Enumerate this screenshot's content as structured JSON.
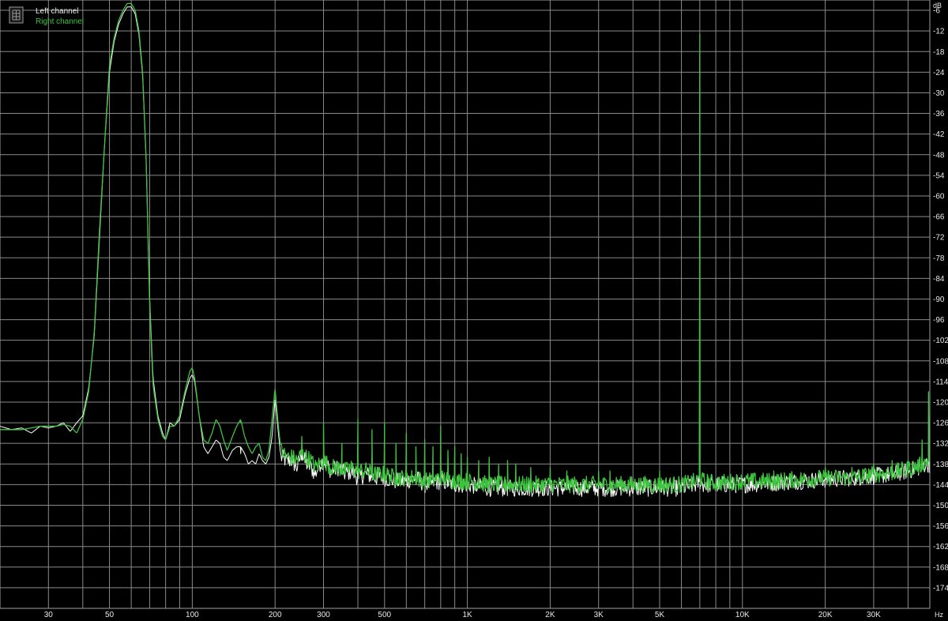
{
  "chart_data": {
    "type": "line",
    "title": "",
    "xlabel": "",
    "ylabel": "",
    "x_unit": "Hz",
    "y_unit": "dB",
    "x_scale": "log",
    "xlim": [
      20,
      48000
    ],
    "ylim": [
      -180,
      -3
    ],
    "grid": true,
    "legend_placement": "top-left",
    "background": "#000000",
    "grid_color": "#8a8a8a",
    "x_ticks": [
      {
        "value": 30,
        "label": "30"
      },
      {
        "value": 50,
        "label": "50"
      },
      {
        "value": 100,
        "label": "100"
      },
      {
        "value": 200,
        "label": "200"
      },
      {
        "value": 300,
        "label": "300"
      },
      {
        "value": 500,
        "label": "500"
      },
      {
        "value": 1000,
        "label": "1K"
      },
      {
        "value": 2000,
        "label": "2K"
      },
      {
        "value": 3000,
        "label": "3K"
      },
      {
        "value": 5000,
        "label": "5K"
      },
      {
        "value": 10000,
        "label": "10K"
      },
      {
        "value": 20000,
        "label": "20K"
      },
      {
        "value": 30000,
        "label": "30K"
      }
    ],
    "y_ticks": [
      -6,
      -12,
      -18,
      -24,
      -30,
      -36,
      -42,
      -48,
      -54,
      -60,
      -66,
      -72,
      -78,
      -84,
      -90,
      -96,
      -102,
      -108,
      -114,
      -120,
      -126,
      -132,
      -138,
      -144,
      -150,
      -156,
      -162,
      -168,
      -174
    ],
    "series": [
      {
        "name": "Left channel",
        "color": "#ffffff",
        "points": [
          [
            20,
            -127
          ],
          [
            22,
            -128
          ],
          [
            24,
            -127.5
          ],
          [
            26,
            -129
          ],
          [
            28,
            -127
          ],
          [
            30,
            -127.5
          ],
          [
            32,
            -127
          ],
          [
            34,
            -126
          ],
          [
            36,
            -128.5
          ],
          [
            38,
            -126
          ],
          [
            40,
            -124
          ],
          [
            42,
            -116
          ],
          [
            44,
            -101
          ],
          [
            46,
            -72
          ],
          [
            48,
            -45
          ],
          [
            50,
            -24
          ],
          [
            52,
            -15
          ],
          [
            54,
            -10
          ],
          [
            56,
            -7
          ],
          [
            58,
            -5
          ],
          [
            60,
            -5
          ],
          [
            62,
            -7
          ],
          [
            64,
            -13
          ],
          [
            66,
            -25
          ],
          [
            68,
            -50
          ],
          [
            70,
            -90
          ],
          [
            72,
            -113
          ],
          [
            75,
            -124
          ],
          [
            78,
            -129
          ],
          [
            80,
            -131
          ],
          [
            83,
            -126
          ],
          [
            86,
            -127
          ],
          [
            90,
            -125
          ],
          [
            94,
            -118
          ],
          [
            98,
            -113
          ],
          [
            100,
            -112
          ],
          [
            102,
            -114
          ],
          [
            106,
            -124
          ],
          [
            110,
            -133
          ],
          [
            114,
            -135
          ],
          [
            118,
            -133
          ],
          [
            122,
            -131
          ],
          [
            126,
            -132
          ],
          [
            130,
            -136
          ],
          [
            134,
            -137
          ],
          [
            140,
            -134
          ],
          [
            145,
            -133
          ],
          [
            150,
            -133
          ],
          [
            155,
            -135
          ],
          [
            160,
            -138
          ],
          [
            165,
            -137
          ],
          [
            170,
            -138
          ],
          [
            175,
            -135
          ],
          [
            180,
            -137
          ],
          [
            185,
            -138
          ],
          [
            190,
            -136
          ],
          [
            195,
            -130
          ],
          [
            200,
            -119
          ],
          [
            205,
            -128
          ],
          [
            210,
            -136
          ],
          [
            220,
            -137
          ],
          [
            230,
            -137
          ],
          [
            240,
            -139
          ],
          [
            250,
            -135
          ],
          [
            260,
            -138
          ],
          [
            270,
            -139
          ],
          [
            280,
            -141
          ],
          [
            290,
            -138
          ],
          [
            300,
            -137
          ],
          [
            320,
            -140
          ],
          [
            340,
            -139
          ],
          [
            360,
            -141
          ],
          [
            380,
            -140
          ],
          [
            400,
            -142
          ],
          [
            430,
            -141
          ],
          [
            460,
            -142
          ],
          [
            500,
            -142
          ],
          [
            550,
            -143
          ],
          [
            600,
            -143
          ],
          [
            650,
            -142
          ],
          [
            700,
            -144
          ],
          [
            800,
            -143
          ],
          [
            900,
            -144
          ],
          [
            1000,
            -144
          ],
          [
            1200,
            -145
          ],
          [
            1500,
            -145
          ],
          [
            2000,
            -145
          ],
          [
            2500,
            -145
          ],
          [
            3000,
            -145
          ],
          [
            4000,
            -145
          ],
          [
            5000,
            -145
          ],
          [
            6000,
            -145
          ],
          [
            6800,
            -144
          ],
          [
            7000,
            -143
          ],
          [
            7200,
            -144
          ],
          [
            8000,
            -144
          ],
          [
            10000,
            -144
          ],
          [
            13000,
            -143.5
          ],
          [
            16000,
            -143
          ],
          [
            20000,
            -142.5
          ],
          [
            25000,
            -142
          ],
          [
            30000,
            -141.5
          ],
          [
            35000,
            -141
          ],
          [
            40000,
            -140
          ],
          [
            44000,
            -139
          ],
          [
            46000,
            -138
          ],
          [
            48000,
            -138
          ]
        ]
      },
      {
        "name": "Right channel",
        "color": "#3ec43e",
        "points": [
          [
            20,
            -128
          ],
          [
            22,
            -128
          ],
          [
            24,
            -128
          ],
          [
            26,
            -127.5
          ],
          [
            28,
            -127
          ],
          [
            30,
            -127
          ],
          [
            32,
            -127
          ],
          [
            34,
            -126.5
          ],
          [
            36,
            -127
          ],
          [
            38,
            -129
          ],
          [
            40,
            -125
          ],
          [
            42,
            -117
          ],
          [
            44,
            -100
          ],
          [
            46,
            -70
          ],
          [
            48,
            -45
          ],
          [
            50,
            -22
          ],
          [
            52,
            -14
          ],
          [
            54,
            -9
          ],
          [
            56,
            -6
          ],
          [
            58,
            -4
          ],
          [
            60,
            -4
          ],
          [
            62,
            -6
          ],
          [
            64,
            -12
          ],
          [
            66,
            -24
          ],
          [
            68,
            -50
          ],
          [
            70,
            -92
          ],
          [
            72,
            -115
          ],
          [
            75,
            -125
          ],
          [
            78,
            -130
          ],
          [
            80,
            -131
          ],
          [
            83,
            -127
          ],
          [
            86,
            -127
          ],
          [
            90,
            -124
          ],
          [
            94,
            -117
          ],
          [
            98,
            -111
          ],
          [
            100,
            -110
          ],
          [
            102,
            -113
          ],
          [
            106,
            -124
          ],
          [
            110,
            -131
          ],
          [
            114,
            -132
          ],
          [
            118,
            -129
          ],
          [
            122,
            -125
          ],
          [
            126,
            -127
          ],
          [
            130,
            -131
          ],
          [
            134,
            -134
          ],
          [
            140,
            -130
          ],
          [
            145,
            -127
          ],
          [
            150,
            -125
          ],
          [
            155,
            -130
          ],
          [
            160,
            -133
          ],
          [
            165,
            -135
          ],
          [
            170,
            -133
          ],
          [
            175,
            -132
          ],
          [
            180,
            -136
          ],
          [
            185,
            -137
          ],
          [
            190,
            -134
          ],
          [
            195,
            -125
          ],
          [
            200,
            -116
          ],
          [
            205,
            -126
          ],
          [
            210,
            -134
          ],
          [
            220,
            -136
          ],
          [
            230,
            -136
          ],
          [
            240,
            -137
          ],
          [
            250,
            -135
          ],
          [
            260,
            -136
          ],
          [
            270,
            -137
          ],
          [
            280,
            -139
          ],
          [
            290,
            -138
          ],
          [
            300,
            -137
          ],
          [
            320,
            -139
          ],
          [
            340,
            -139
          ],
          [
            360,
            -140
          ],
          [
            380,
            -139
          ],
          [
            400,
            -140
          ],
          [
            430,
            -140
          ],
          [
            460,
            -141
          ],
          [
            500,
            -141
          ],
          [
            550,
            -142
          ],
          [
            600,
            -142
          ],
          [
            650,
            -142
          ],
          [
            700,
            -143
          ],
          [
            800,
            -142
          ],
          [
            900,
            -143
          ],
          [
            1000,
            -143
          ],
          [
            1200,
            -144
          ],
          [
            1500,
            -144
          ],
          [
            2000,
            -144
          ],
          [
            2500,
            -144
          ],
          [
            3000,
            -144
          ],
          [
            4000,
            -144
          ],
          [
            5000,
            -144
          ],
          [
            6000,
            -144
          ],
          [
            6800,
            -143
          ],
          [
            7000,
            -142
          ],
          [
            7200,
            -143
          ],
          [
            8000,
            -143.5
          ],
          [
            10000,
            -143
          ],
          [
            13000,
            -143
          ],
          [
            16000,
            -142.5
          ],
          [
            20000,
            -142
          ],
          [
            25000,
            -142
          ],
          [
            30000,
            -141
          ],
          [
            35000,
            -140.5
          ],
          [
            40000,
            -139.5
          ],
          [
            44000,
            -138.5
          ],
          [
            46000,
            -137.5
          ],
          [
            48000,
            -137
          ]
        ]
      }
    ],
    "peaks": [
      {
        "x": 150,
        "left": -135,
        "right": -126
      },
      {
        "x": 250,
        "left": -136,
        "right": -130
      },
      {
        "x": 300,
        "left": -134,
        "right": -126
      },
      {
        "x": 350,
        "left": -138,
        "right": -132
      },
      {
        "x": 400,
        "left": -133,
        "right": -125
      },
      {
        "x": 450,
        "left": -136,
        "right": -128
      },
      {
        "x": 500,
        "left": -134,
        "right": -126
      },
      {
        "x": 550,
        "left": -138,
        "right": -132
      },
      {
        "x": 600,
        "left": -136,
        "right": -129
      },
      {
        "x": 650,
        "left": -139,
        "right": -133
      },
      {
        "x": 700,
        "left": -137,
        "right": -131
      },
      {
        "x": 750,
        "left": -138,
        "right": -133
      },
      {
        "x": 800,
        "left": -133,
        "right": -127
      },
      {
        "x": 850,
        "left": -139,
        "right": -134
      },
      {
        "x": 900,
        "left": -138,
        "right": -133
      },
      {
        "x": 950,
        "left": -140,
        "right": -135
      },
      {
        "x": 1000,
        "left": -139,
        "right": -136
      },
      {
        "x": 1100,
        "left": -140,
        "right": -137
      },
      {
        "x": 1200,
        "left": -139,
        "right": -136
      },
      {
        "x": 1300,
        "left": -141,
        "right": -138
      },
      {
        "x": 1400,
        "left": -140,
        "right": -137
      },
      {
        "x": 1500,
        "left": -140,
        "right": -138
      },
      {
        "x": 1700,
        "left": -141,
        "right": -139
      },
      {
        "x": 2000,
        "left": -141,
        "right": -139
      },
      {
        "x": 2300,
        "left": -142,
        "right": -140
      },
      {
        "x": 3000,
        "left": -141,
        "right": -140
      },
      {
        "x": 3300,
        "left": -142,
        "right": -140
      },
      {
        "x": 5000,
        "left": -142,
        "right": -140
      },
      {
        "x": 7000,
        "left": -18,
        "right": -13
      },
      {
        "x": 13000,
        "left": -141,
        "right": -140
      },
      {
        "x": 20000,
        "left": -140,
        "right": -139
      },
      {
        "x": 25000,
        "left": -140,
        "right": -139
      },
      {
        "x": 30000,
        "left": -139,
        "right": -138
      },
      {
        "x": 35000,
        "left": -139,
        "right": -137
      },
      {
        "x": 40000,
        "left": -138,
        "right": -137
      },
      {
        "x": 45000,
        "left": -133,
        "right": -131
      },
      {
        "x": 47500,
        "left": -118,
        "right": -117
      }
    ]
  }
}
